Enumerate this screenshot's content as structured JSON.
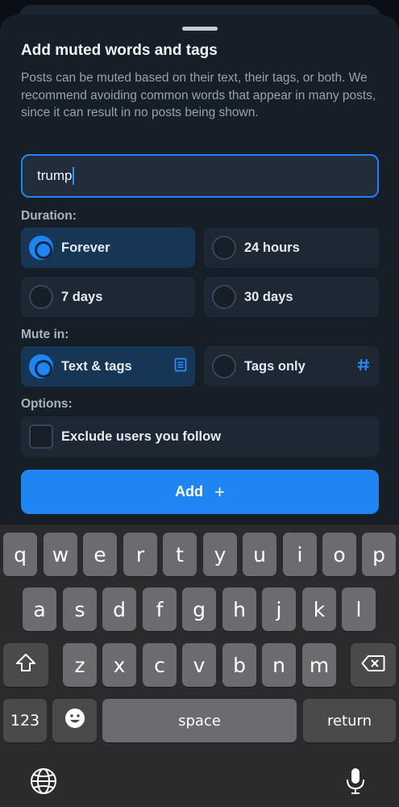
{
  "sheet": {
    "title": "Add muted words and tags",
    "description": "Posts can be muted based on their text, their tags, or both. We recommend avoiding common words that appear in many posts, since it can result in no posts being shown.",
    "input_value": "trump"
  },
  "duration": {
    "label": "Duration:",
    "options": [
      "Forever",
      "24 hours",
      "7 days",
      "30 days"
    ],
    "selected": "Forever"
  },
  "mute_in": {
    "label": "Mute in:",
    "options": [
      "Text & tags",
      "Tags only"
    ],
    "selected": "Text & tags"
  },
  "options": {
    "label": "Options:",
    "exclude_label": "Exclude users you follow",
    "exclude_checked": false
  },
  "add_button": {
    "label": "Add",
    "icon": "+"
  },
  "keyboard": {
    "row1": [
      "q",
      "w",
      "e",
      "r",
      "t",
      "y",
      "u",
      "i",
      "o",
      "p"
    ],
    "row2": [
      "a",
      "s",
      "d",
      "f",
      "g",
      "h",
      "j",
      "k",
      "l"
    ],
    "row3": [
      "z",
      "x",
      "c",
      "v",
      "b",
      "n",
      "m"
    ],
    "numbers_label": "123",
    "space_label": "space",
    "return_label": "return",
    "emoji_icon": "emoji-icon",
    "globe_icon": "globe-icon",
    "mic_icon": "microphone-icon"
  },
  "colors": {
    "accent": "#1f85f2",
    "sheet_bg": "#161e28",
    "option_bg": "#1e2835",
    "selected_bg": "#173554",
    "key_bg": "#6c6c70",
    "key_dark_bg": "#4a4a4d"
  }
}
